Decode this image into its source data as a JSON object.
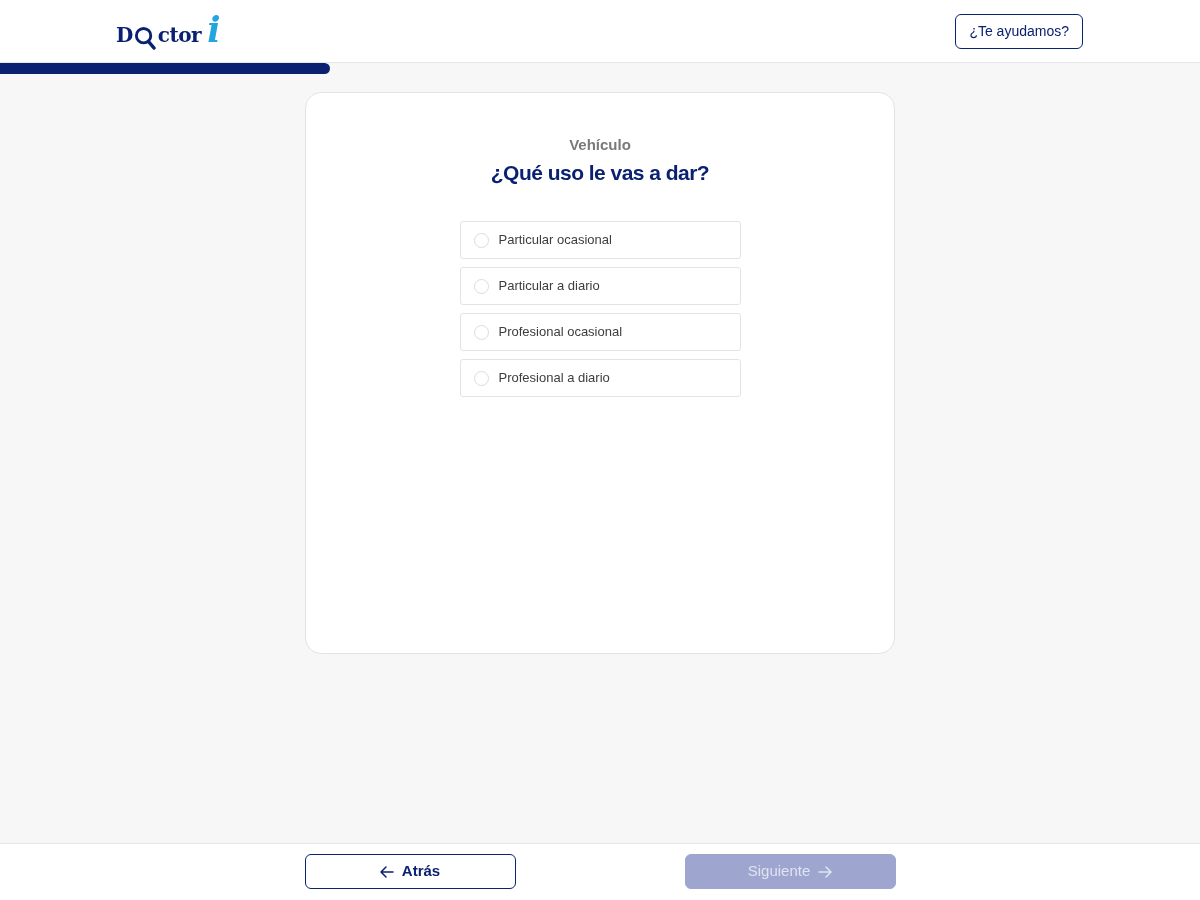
{
  "header": {
    "logo": {
      "before": "D",
      "after": "ctor",
      "mark": "i"
    },
    "help_button": "¿Te ayudamos?"
  },
  "progress": {
    "level": 0.275
  },
  "question": {
    "section": "Vehículo",
    "title": "¿Qué uso le vas a dar?",
    "options": [
      {
        "label": "Particular ocasional",
        "selected": false
      },
      {
        "label": "Particular a diario",
        "selected": false
      },
      {
        "label": "Profesional ocasional",
        "selected": false
      },
      {
        "label": "Profesional a diario",
        "selected": false
      }
    ]
  },
  "footer": {
    "back_button": {
      "label": "Atrás",
      "disabled": false
    },
    "next_button": {
      "label": "Siguiente",
      "disabled": true
    }
  }
}
